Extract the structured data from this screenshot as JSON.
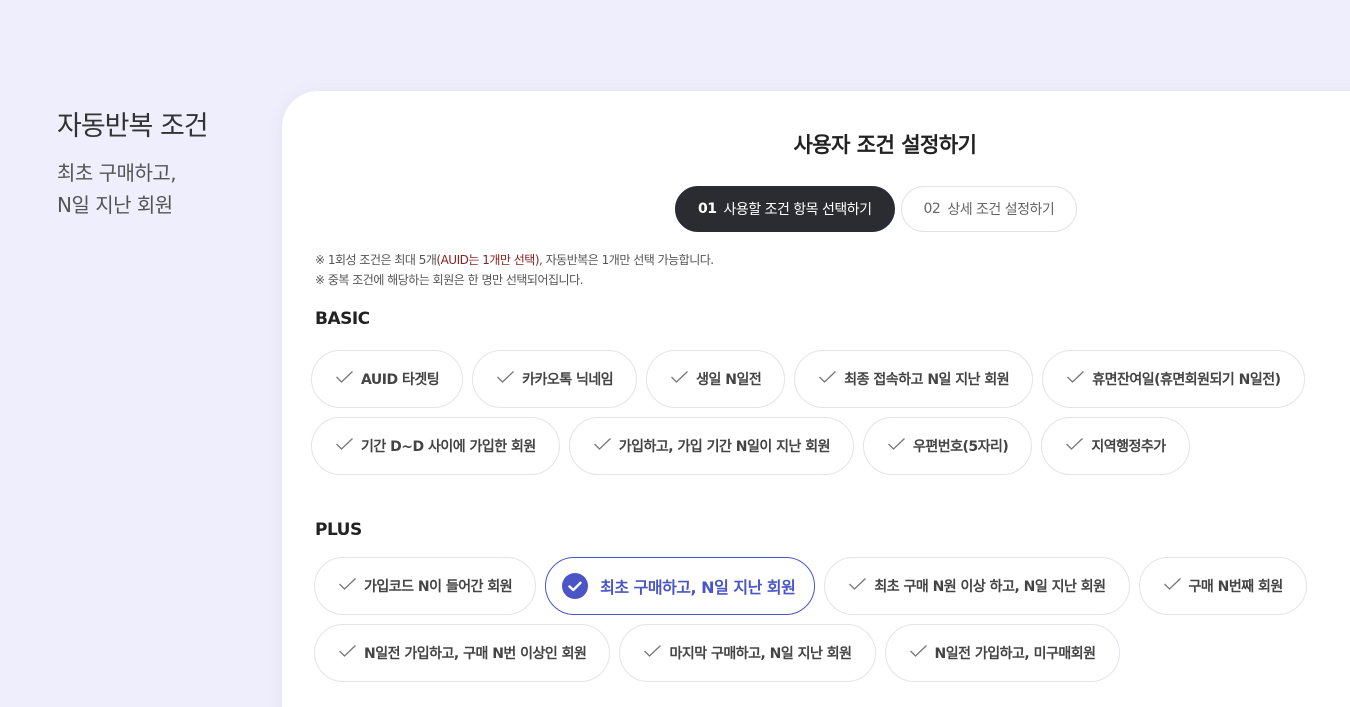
{
  "side": {
    "title": "자동반복 조건",
    "desc_line1": "최초 구매하고,",
    "desc_line2": "N일 지난 회원"
  },
  "panel": {
    "title": "사용자 조건 설정하기",
    "steps": [
      {
        "num": "01",
        "label": "사용할 조건 항목 선택하기",
        "active": true
      },
      {
        "num": "02",
        "label": "상세 조건 설정하기",
        "active": false
      }
    ],
    "notes": {
      "line1_pre": "※ 1회성 조건은 최대 5개",
      "line1_hl": "(AUID는 1개만 선택)",
      "line1_post": ", 자동반복은 1개만 선택 가능합니다.",
      "line2": "※ 중복 조건에 해당하는 회원은 한 명만 선택되어집니다."
    }
  },
  "basic": {
    "label": "BASIC",
    "rows": [
      [
        "AUID 타겟팅",
        "카카오톡 닉네임",
        "생일 N일전",
        "최종 접속하고 N일 지난 회원",
        "휴면잔여일(휴면회원되기 N일전)"
      ],
      [
        "기간 D~D 사이에 가입한 회원",
        "가입하고, 가입 기간 N일이 지난 회원",
        "우편번호(5자리)",
        "지역행정추가"
      ]
    ]
  },
  "plus": {
    "label": "PLUS",
    "rows": [
      [
        "가입코드 N이 들어간 회원",
        "최초 구매하고, N일 지난 회원",
        "최초 구매 N원 이상 하고, N일 지난 회원",
        "구매 N번째 회원"
      ],
      [
        "N일전 가입하고, 구매 N번 이상인 회원",
        "마지막 구매하고, N일 지난 회원",
        "N일전 가입하고, 미구매회원"
      ]
    ],
    "selected": "최초 구매하고, N일 지난 회원"
  },
  "colors": {
    "background": "#eeeefc",
    "accent": "#4a56c6",
    "active_step": "#2a2c31",
    "highlight_text": "#8a1f1f"
  },
  "icons": {
    "chip_check": "check-icon",
    "selected_check": "check-circle-icon"
  }
}
